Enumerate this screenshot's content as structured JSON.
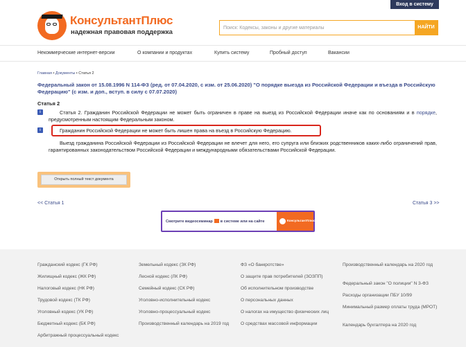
{
  "header": {
    "login_label": "Вход в систему",
    "logo_title": "КонсультантПлюс",
    "logo_subtitle": "надежная правовая поддержка",
    "search_placeholder": "Поиск: Кодексы, законы и другие материалы",
    "search_button": "НАЙТИ"
  },
  "nav": {
    "items": [
      "Некоммерческие интернет-версии",
      "О компании и продуктах",
      "Купить систему",
      "Пробный доступ",
      "Вакансии"
    ]
  },
  "breadcrumb": {
    "home": "Главная",
    "docs": "Документы",
    "current": "Статья 2",
    "sep": " • "
  },
  "document": {
    "title": "Федеральный закон от 15.08.1996 N 114-ФЗ (ред. от 07.04.2020, с изм. от 25.06.2020) \"О порядке выезда из Российской Федерации и въезда в Российскую Федерацию\" (с изм. и доп., вступ. в силу с 07.07.2020)",
    "article_title": "Статья 2",
    "info_icon_glyph": "i",
    "para1_before": "Статья 2. Гражданин Российской Федерации не может быть ограничен в праве на выезд из Российской Федерации иначе как по основаниям и в ",
    "para1_link": "порядке",
    "para1_after": ", предусмотренным настоящим Федеральным законом.",
    "para2": "Гражданин Российской Федерации не может быть лишен права на въезд в Российскую Федерацию.",
    "para3": "Выезд гражданина Российской Федерации из Российской Федерации не влечет для него, его супруга или близких родственников каких-либо ограничений прав, гарантированных законодательством Российской Федерации и международными обязательствами Российской Федерации.",
    "open_full_button": "Открыть полный текст документа",
    "prev_link": "<< Статья 1",
    "next_link": "Статья 3 >>"
  },
  "banner": {
    "text_before": "Смотрите видеосеминар",
    "text_after": "в системе или на сайте",
    "logo_text": "КонсультантПлюс"
  },
  "footer": {
    "col1": [
      "Гражданский кодекс (ГК РФ)",
      "Жилищный кодекс (ЖК РФ)",
      "Налоговый кодекс (НК РФ)",
      "Трудовой кодекс (ТК РФ)",
      "Уголовный кодекс (УК РФ)",
      "Бюджетный кодекс (БК РФ)",
      "Арбитражный процессуальный кодекс"
    ],
    "col2": [
      "Земельный кодекс (ЗК РФ)",
      "Лесной кодекс (ЛК РФ)",
      "Семейный кодекс (СК РФ)",
      "Уголовно-исполнительный кодекс",
      "Уголовно-процессуальный кодекс",
      "Производственный календарь на 2019 год"
    ],
    "col3": [
      "ФЗ «О банкротстве»",
      "О защите прав потребителей (ЗОЗПП)",
      "Об исполнительном производстве",
      "О персональных данных",
      "О налогах на имущество физических лиц",
      "О средствах массовой информации"
    ],
    "col4": [
      "Производственный календарь на 2020 год",
      "Федеральный закон \"О полиции\" N 3-ФЗ",
      "Расходы организации ПБУ 10/99",
      "Минимальный размер оплаты труда (МРОТ)",
      "Календарь бухгалтера на 2020 год"
    ]
  }
}
